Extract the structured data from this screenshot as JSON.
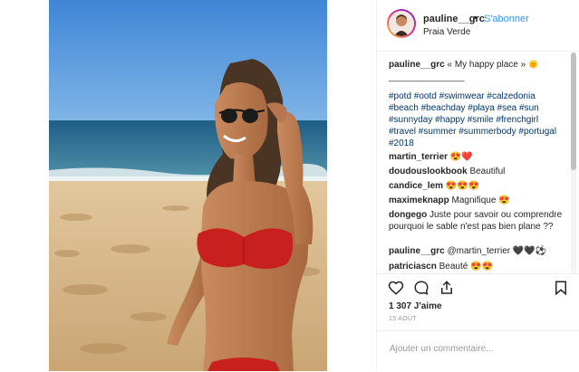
{
  "post": {
    "username": "pauline__grc",
    "dot": "•",
    "follow_label": "S'abonner",
    "location": "Praia Verde"
  },
  "caption": {
    "username": "pauline__grc",
    "text": "« My happy place »",
    "emoji": "🌞",
    "separator": "_______________",
    "hashtags": "#potd #ootd #swimwear #calzedonia #beach #beachday #playa #sea #sun #sunnyday #happy #smile #frenchgirl #travel #summer #summerbody #portugal #2018"
  },
  "comments": [
    {
      "user": "martin_terrier",
      "text": "😍❤️"
    },
    {
      "user": "doudouslookbook",
      "text": "Beautiful"
    },
    {
      "user": "candice_lem",
      "text": "😍😍😍"
    },
    {
      "user": "maximeknapp",
      "text": "Magnifique 😍"
    },
    {
      "user": "dongego",
      "text": "Juste pour savoir ou comprendre pourquoi le sable n'est pas bien plane ??"
    },
    {
      "user": "pauline__grc",
      "text": "@martin_terrier 🖤🖤⚽"
    },
    {
      "user": "patriciascn",
      "text": "Beauté 😍😍"
    }
  ],
  "likes": "1 307 J'aime",
  "date": "15 AOÛT",
  "add_comment_placeholder": "Ajouter un commentaire...",
  "colors": {
    "link": "#3897f0",
    "hashtag": "#003569",
    "sky": "#4f93d8",
    "sea": "#2b6f95",
    "sand": "#d9b88a",
    "bikini": "#c8201f"
  },
  "icons": {
    "like": "heart-icon",
    "comment": "comment-icon",
    "share": "share-icon",
    "save": "bookmark-icon"
  }
}
